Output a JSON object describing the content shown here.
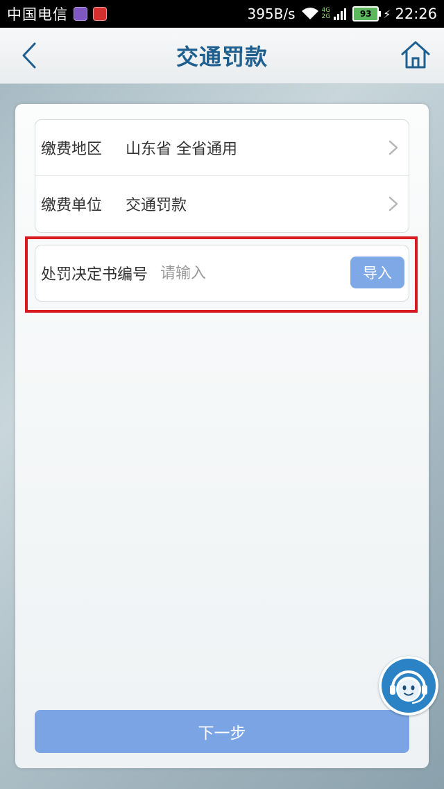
{
  "status_bar": {
    "carrier": "中国电信",
    "speed": "395B/s",
    "network_top": "4G",
    "network_bottom": "2G",
    "battery": "93",
    "time": "22:26"
  },
  "header": {
    "title": "交通罚款",
    "back_icon": "back-chevron-icon",
    "home_icon": "home-icon"
  },
  "form": {
    "rows": [
      {
        "label": "缴费地区",
        "value": "山东省 全省通用"
      },
      {
        "label": "缴费单位",
        "value": "交通罚款"
      }
    ],
    "decision_number": {
      "label": "处罚决定书编号",
      "placeholder": "请输入",
      "value": "",
      "import_label": "导入"
    },
    "next_label": "下一步"
  },
  "colors": {
    "title": "#1f5f8f",
    "primary_button": "#7aa4e3",
    "highlight": "#d7191f"
  }
}
